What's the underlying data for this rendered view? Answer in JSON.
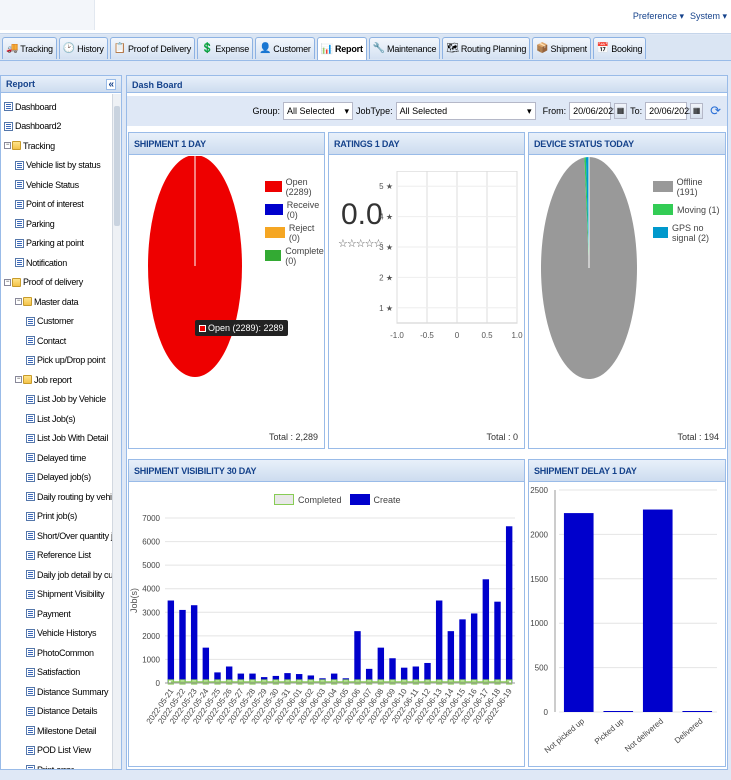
{
  "header": {
    "preference": "Preference ▾",
    "system": "System ▾"
  },
  "tabs": [
    {
      "label": "Tracking",
      "icon": "tracking-icon",
      "glyph": "🚚"
    },
    {
      "label": "History",
      "icon": "history-icon",
      "glyph": "🕑"
    },
    {
      "label": "Proof of Delivery",
      "icon": "delivery-icon",
      "glyph": "📋"
    },
    {
      "label": "Expense",
      "icon": "expense-icon",
      "glyph": "💲"
    },
    {
      "label": "Customer",
      "icon": "customer-icon",
      "glyph": "👤"
    },
    {
      "label": "Report",
      "icon": "report-icon",
      "glyph": "📊"
    },
    {
      "label": "Maintenance",
      "icon": "maintenance-icon",
      "glyph": "🔧"
    },
    {
      "label": "Routing Planning",
      "icon": "routing-icon",
      "glyph": "🗺"
    },
    {
      "label": "Shipment",
      "icon": "shipment-icon",
      "glyph": "📦"
    },
    {
      "label": "Booking",
      "icon": "booking-icon",
      "glyph": "📅"
    }
  ],
  "active_tab": "Report",
  "left_panel": {
    "title": "Report",
    "collapse": "«"
  },
  "tree": [
    {
      "label": "Dashboard",
      "level": 0,
      "type": "page"
    },
    {
      "label": "Dashboard2",
      "level": 0,
      "type": "page"
    },
    {
      "label": "Tracking",
      "level": 0,
      "type": "folder"
    },
    {
      "label": "Vehicle list by status",
      "level": 1,
      "type": "page"
    },
    {
      "label": "Vehicle Status",
      "level": 1,
      "type": "page"
    },
    {
      "label": "Point of interest",
      "level": 1,
      "type": "page"
    },
    {
      "label": "Parking",
      "level": 1,
      "type": "page"
    },
    {
      "label": "Parking at point",
      "level": 1,
      "type": "page"
    },
    {
      "label": "Notification",
      "level": 1,
      "type": "page"
    },
    {
      "label": "Proof of delivery",
      "level": 0,
      "type": "folder"
    },
    {
      "label": "Master data",
      "level": 1,
      "type": "folder"
    },
    {
      "label": "Customer",
      "level": 2,
      "type": "page"
    },
    {
      "label": "Contact",
      "level": 2,
      "type": "page"
    },
    {
      "label": "Pick up/Drop point",
      "level": 2,
      "type": "page"
    },
    {
      "label": "Job report",
      "level": 1,
      "type": "folder"
    },
    {
      "label": "List Job by Vehicle",
      "level": 2,
      "type": "page"
    },
    {
      "label": "List Job(s)",
      "level": 2,
      "type": "page"
    },
    {
      "label": "List Job With Detail",
      "level": 2,
      "type": "page"
    },
    {
      "label": "Delayed time",
      "level": 2,
      "type": "page"
    },
    {
      "label": "Delayed job(s)",
      "level": 2,
      "type": "page"
    },
    {
      "label": "Daily routing by vehicle",
      "level": 2,
      "type": "page"
    },
    {
      "label": "Print job(s)",
      "level": 2,
      "type": "page"
    },
    {
      "label": "Short/Over quantity job list",
      "level": 2,
      "type": "page"
    },
    {
      "label": "Reference List",
      "level": 2,
      "type": "page"
    },
    {
      "label": "Daily job detail by customer",
      "level": 2,
      "type": "page"
    },
    {
      "label": "Shipment Visibility",
      "level": 2,
      "type": "page"
    },
    {
      "label": "Payment",
      "level": 2,
      "type": "page"
    },
    {
      "label": "Vehicle Historys",
      "level": 2,
      "type": "page"
    },
    {
      "label": "PhotoCommon",
      "level": 2,
      "type": "page"
    },
    {
      "label": "Satisfaction",
      "level": 2,
      "type": "page"
    },
    {
      "label": "Distance Summary",
      "level": 2,
      "type": "page"
    },
    {
      "label": "Distance Details",
      "level": 2,
      "type": "page"
    },
    {
      "label": "Milestone Detail",
      "level": 2,
      "type": "page"
    },
    {
      "label": "POD List View",
      "level": 2,
      "type": "page"
    },
    {
      "label": "Print error",
      "level": 2,
      "type": "page"
    }
  ],
  "main": {
    "title": "Dash Board"
  },
  "filter": {
    "group_label": "Group:",
    "group_value": "All Selected",
    "jobtype_label": "JobType:",
    "jobtype_value": "All Selected",
    "from_label": "From:",
    "from_value": "20/06/2022",
    "to_label": "To:",
    "to_value": "20/06/2022"
  },
  "panels": {
    "shipment1": {
      "title": "SHIPMENT 1 DAY",
      "total": "Total : 2,289",
      "tooltip": "Open (2289): 2289",
      "legend": [
        {
          "label": "Open (2289)",
          "color": "#ee0000"
        },
        {
          "label": "Receive (0)",
          "color": "#0000cc"
        },
        {
          "label": "Reject (0)",
          "color": "#f5a623"
        },
        {
          "label": "Complete (0)",
          "color": "#33aa33"
        }
      ]
    },
    "ratings": {
      "title": "RATINGS 1 DAY",
      "score": "0.0",
      "stars": "☆☆☆☆☆",
      "total": "Total : 0"
    },
    "device": {
      "title": "DEVICE STATUS TODAY",
      "total": "Total : 194",
      "legend": [
        {
          "label": "Offline (191)",
          "color": "#999999"
        },
        {
          "label": "Moving (1)",
          "color": "#33cc55"
        },
        {
          "label": "GPS no signal (2)",
          "color": "#0099cc"
        }
      ]
    },
    "visibility": {
      "title": "SHIPMENT VISIBILITY 30 DAY",
      "legend_completed": "Completed",
      "legend_create": "Create",
      "ylabel": "Job(s)"
    },
    "delay": {
      "title": "SHIPMENT DELAY 1 DAY"
    }
  },
  "chart_data": [
    {
      "type": "pie",
      "title": "SHIPMENT 1 DAY",
      "slices": [
        {
          "name": "Open",
          "value": 2289,
          "color": "#ee0000"
        },
        {
          "name": "Receive",
          "value": 0
        },
        {
          "name": "Reject",
          "value": 0
        },
        {
          "name": "Complete",
          "value": 0
        }
      ]
    },
    {
      "type": "scatter",
      "title": "RATINGS 1 DAY",
      "xticks": [
        "-1.0",
        "-0.5",
        "0",
        "0.5",
        "1.0"
      ],
      "yticks": [
        "1 ★",
        "2 ★",
        "3 ★",
        "4 ★",
        "5 ★"
      ],
      "xlim": [
        -1,
        1
      ],
      "ylim": [
        0.5,
        5.5
      ],
      "grid": true
    },
    {
      "type": "pie",
      "title": "DEVICE STATUS TODAY",
      "slices": [
        {
          "name": "Offline",
          "value": 191,
          "color": "#999999"
        },
        {
          "name": "Moving",
          "value": 1,
          "color": "#33cc55"
        },
        {
          "name": "GPS no signal",
          "value": 2,
          "color": "#0099cc"
        }
      ]
    },
    {
      "type": "bar",
      "title": "SHIPMENT VISIBILITY 30 DAY",
      "ylabel": "Job(s)",
      "ylim": [
        0,
        7000
      ],
      "yticks": [
        0,
        1000,
        2000,
        3000,
        4000,
        5000,
        6000,
        7000
      ],
      "grid": true,
      "categories": [
        "2022-05-21",
        "2022-05-22",
        "2022-05-23",
        "2022-05-24",
        "2022-05-25",
        "2022-05-26",
        "2022-05-27",
        "2022-05-28",
        "2022-05-29",
        "2022-05-30",
        "2022-05-31",
        "2022-06-01",
        "2022-06-02",
        "2022-06-03",
        "2022-06-04",
        "2022-06-05",
        "2022-06-06",
        "2022-06-07",
        "2022-06-08",
        "2022-06-09",
        "2022-06-10",
        "2022-06-11",
        "2022-06-12",
        "2022-06-13",
        "2022-06-14",
        "2022-06-15",
        "2022-06-16",
        "2022-06-17",
        "2022-06-18",
        "2022-06-19"
      ],
      "series": [
        {
          "name": "Completed",
          "color": "#88cc55",
          "values": [
            0,
            0,
            0,
            0,
            0,
            0,
            0,
            0,
            0,
            0,
            0,
            0,
            0,
            0,
            0,
            0,
            0,
            0,
            0,
            0,
            0,
            0,
            0,
            0,
            0,
            0,
            0,
            0,
            0,
            0
          ]
        },
        {
          "name": "Create",
          "color": "#0000cc",
          "values": [
            3500,
            3100,
            3300,
            1500,
            450,
            700,
            400,
            400,
            250,
            300,
            420,
            380,
            320,
            200,
            400,
            200,
            2200,
            600,
            1500,
            1050,
            650,
            700,
            850,
            3500,
            2200,
            2700,
            2950,
            4400,
            3450,
            6650
          ]
        }
      ]
    },
    {
      "type": "bar",
      "title": "SHIPMENT DELAY 1 DAY",
      "ylim": [
        0,
        2500
      ],
      "yticks": [
        0,
        500,
        1000,
        1500,
        2000,
        2500
      ],
      "grid": true,
      "categories": [
        "Not picked up",
        "Picked up",
        "Not delivered",
        "Delivered"
      ],
      "values": [
        2240,
        0,
        2280,
        0
      ]
    }
  ]
}
